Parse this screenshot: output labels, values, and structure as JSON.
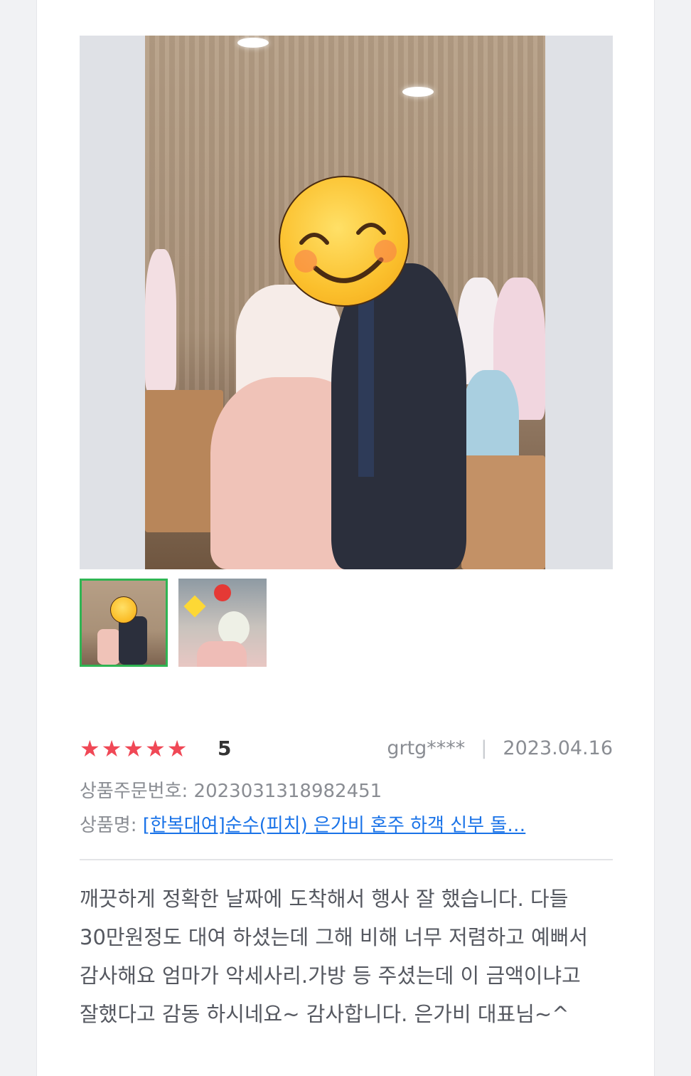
{
  "review": {
    "rating": 5,
    "rating_display": "5",
    "stars": [
      "★",
      "★",
      "★",
      "★",
      "★"
    ],
    "author": "grtg****",
    "separator": "|",
    "date": "2023.04.16",
    "order_label": "상품주문번호:",
    "order_number": "2023031318982451",
    "product_label": "상품명:",
    "product_name": "[한복대여]순수(피치) 은가비 혼주 하객 신부 돌…",
    "body": "깨끗하게 정확한 날짜에 도착해서 행사 잘 했습니다. 다들 30만원정도 대여 하셨는데 그해 비해 너무 저렴하고 예뻐서 감사해요 엄마가 악세사리.가방 등 주셨는데 이 금액이냐고 잘했다고 감동 하시네요~ 감사합니다. 은가비 대표님~^"
  },
  "photos": {
    "main_icon": "smiling-face-emoji",
    "thumbnails": [
      {
        "name": "thumb-couple-photo",
        "selected": true
      },
      {
        "name": "thumb-bouquet-photo",
        "selected": false
      }
    ]
  },
  "colors": {
    "star": "#f04856",
    "selected_border": "#2fb553",
    "link": "#1a73e8"
  }
}
